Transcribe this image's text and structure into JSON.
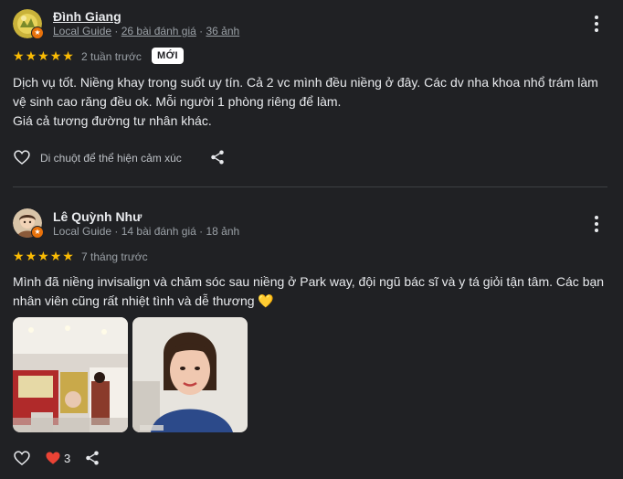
{
  "reviews": [
    {
      "author": "Đình Giang",
      "level": "Local Guide",
      "sep": " · ",
      "review_count": "26 bài đánh giá",
      "photo_count": "36 ảnh",
      "rating": 5,
      "time": "2 tuần trước",
      "badge": "MỚI",
      "text_lines": [
        "Dịch vụ tốt. Niềng khay trong suốt uy tín. Cả 2 vc mình đều niềng ở đây. Các dv nha khoa nhổ trám làm",
        "vệ sinh cao răng đều ok. Mỗi người 1 phòng riêng để làm.",
        "Giá cả tương đường tư nhân khác."
      ],
      "reaction_hint": "Di chuột để thể hiện cảm xúc"
    },
    {
      "author": "Lê Quỳnh Như",
      "level": "Local Guide",
      "sep": " · ",
      "review_count": "14 bài đánh giá",
      "photo_count": "18 ảnh",
      "rating": 5,
      "time": "7 tháng trước",
      "text_lines": [
        "Mình đã niềng invisalign và chăm sóc sau niềng ở Park way, đội ngũ bác sĩ và y tá giỏi tận tâm. Các bạn",
        "nhân viên cũng rất nhiệt tình và dễ thương 💛"
      ],
      "like_count": "3"
    }
  ],
  "colors": {
    "star": "#fbbc04",
    "heart": "#ea4335",
    "badge": "#e8710a"
  },
  "icons": [
    "heart-outline-icon",
    "share-icon",
    "more-vert-icon",
    "heart-filled-icon",
    "local-guide-star-icon"
  ]
}
